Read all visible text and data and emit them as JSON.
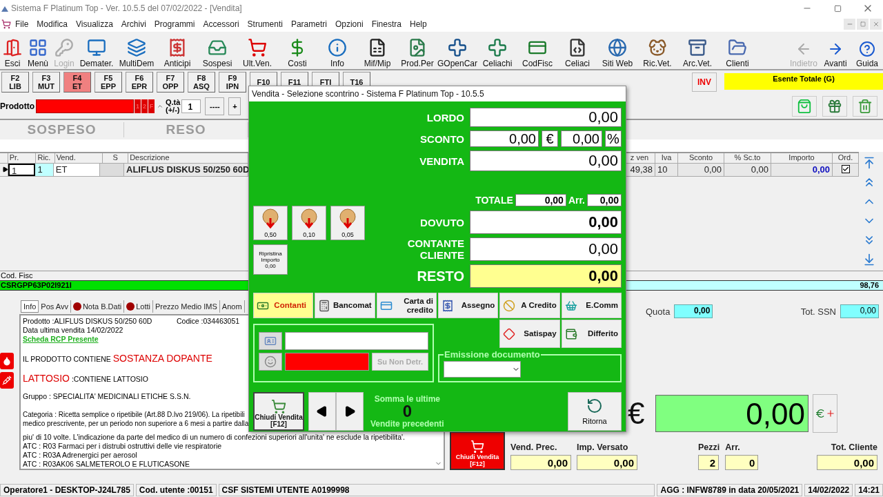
{
  "window": {
    "title": "Sistema F Platinum Top - Ver. 10.5.5 del 07/02/2022 - [Vendita]"
  },
  "menu": [
    "File",
    "Modifica",
    "Visualizza",
    "Archivi",
    "Programmi",
    "Accessori",
    "Strumenti",
    "Parametri",
    "Opzioni",
    "Finestra",
    "Help"
  ],
  "toolbar": [
    {
      "label": "Esci",
      "disabled": false
    },
    {
      "label": "Menù",
      "disabled": false
    },
    {
      "label": "Login",
      "disabled": true
    },
    {
      "label": "Demater.",
      "disabled": false
    },
    {
      "label": "MultiDem",
      "disabled": false
    },
    {
      "label": "Anticipi",
      "disabled": false
    },
    {
      "label": "Sospesi",
      "disabled": false
    },
    {
      "label": "Ult.Ven.",
      "disabled": false
    },
    {
      "label": "Costi",
      "disabled": false
    },
    {
      "label": "Info",
      "disabled": false
    },
    {
      "label": "Mif/Mip",
      "disabled": false
    },
    {
      "label": "Prod.Per",
      "disabled": false
    },
    {
      "label": "GOpenCar",
      "disabled": false
    },
    {
      "label": "Celiachi",
      "disabled": false
    },
    {
      "label": "CodFisc",
      "disabled": false
    },
    {
      "label": "Celiaci",
      "disabled": false
    },
    {
      "label": "Siti Web",
      "disabled": false
    },
    {
      "label": "Ric.Vet.",
      "disabled": false
    },
    {
      "label": "Arc.Vet.",
      "disabled": false
    },
    {
      "label": "Clienti",
      "disabled": false
    }
  ],
  "nav_toolbar": [
    {
      "label": "Indietro",
      "disabled": true
    },
    {
      "label": "Avanti",
      "disabled": false
    },
    {
      "label": "Guida",
      "disabled": false
    }
  ],
  "function_keys": [
    {
      "key": "F2",
      "code": "LIB",
      "selected": false
    },
    {
      "key": "F3",
      "code": "MUT",
      "selected": false
    },
    {
      "key": "F4",
      "code": "ET",
      "selected": true
    },
    {
      "key": "F5",
      "code": "EPP",
      "selected": false
    },
    {
      "key": "F6",
      "code": "EPR",
      "selected": false
    },
    {
      "key": "F7",
      "code": "OPP",
      "selected": false
    },
    {
      "key": "F8",
      "code": "ASQ",
      "selected": false
    },
    {
      "key": "F9",
      "code": "IPN",
      "selected": false
    },
    {
      "key": "F10",
      "selected": false
    },
    {
      "key": "F11",
      "selected": false
    },
    {
      "key": "FTI",
      "selected": false
    },
    {
      "key": "T16",
      "selected": false
    }
  ],
  "inv_button": "INV",
  "exemption": "Esente Totale (G)",
  "product": {
    "label": "Prodotto",
    "flags": [
      "1",
      "2",
      "F"
    ],
    "qty_label": "Q.tà",
    "qty_sub": "(+/-)",
    "qty": "1",
    "more_button": "----",
    "plus_button": "+"
  },
  "modes": [
    {
      "label": "SOSPESO",
      "disabled": true
    },
    {
      "label": "RESO",
      "disabled": true
    }
  ],
  "table": {
    "columns_left": [
      "Pr.",
      "Ric.",
      "Vend.",
      "S",
      "Descrizione"
    ],
    "columns_right": [
      "z ven",
      "Iva",
      "Sconto",
      "% Sc.to",
      "Importo",
      "Ord."
    ],
    "rows": [
      {
        "pr": "1",
        "ric": "1",
        "vend": "ET",
        "descrizione": "ALIFLUS DISKUS 50/250 60D",
        "prz_ven": "49,38",
        "iva": "10",
        "sconto": "0,00",
        "perc_sconto": "0,00",
        "importo": "0,00",
        "ord": true
      }
    ]
  },
  "cod_fisc": {
    "label": "Cod. Fisc",
    "value": "CSRGPP63P02I921I"
  },
  "total_bar": "98,76",
  "info_tabs": [
    {
      "label": "Info",
      "selected": true,
      "alert": false
    },
    {
      "label": "Pos Avv",
      "selected": false,
      "alert": false
    },
    {
      "label": "Nota B.Dati",
      "selected": false,
      "alert": true
    },
    {
      "label": "Lotti",
      "selected": false,
      "alert": true
    },
    {
      "label": "Prezzo Medio IMS",
      "selected": false,
      "alert": false
    },
    {
      "label": "Anom",
      "selected": false,
      "alert": false
    }
  ],
  "info": {
    "product": "Prodotto :ALIFLUS DISKUS 50/250 60D",
    "code": "Codice :034463051",
    "last_sale": "Data ultima vendita 14/02/2022",
    "rcp_link": "Scheda RCP Presente",
    "doping_prefix": "IL PRODOTTO CONTIENE",
    "doping_alert": "SOSTANZA DOPANTE",
    "lactose_alert": "LATTOSIO",
    "lactose_text": ":CONTIENE LATTOSIO",
    "group": "Gruppo : SPECIALITA' MEDICINALI ETICHE S.S.N.",
    "category_lines": [
      "Categoria : Ricetta semplice o ripetibile (Art.88 D.lvo 219/06).  La ripetibili",
      "medico prescrivente, per un periodo non superiore a 6 mesi a partire dalla"
    ],
    "lines": [
      "piu' di 10 volte. L'indicazione da parte del medico di un numero di confezioni superiori all'unita' ne esclude la ripetibilita'.",
      "ATC : R03 Farmaci per i distrubi ostruttivi delle vie respiratorie",
      "ATC : R03A Adrenergici per aerosol",
      "ATC : R03AK06 SALMETEROLO E FLUTICASONE"
    ]
  },
  "right_panel": {
    "quota_label": "Quota",
    "quota": "0,00",
    "ssn_label": "Tot. SSN",
    "ssn": "0,00",
    "currency": "€",
    "amount": "0,00"
  },
  "footer": {
    "close_button": {
      "title": "Chiudi Vendita",
      "key": "[F12]"
    },
    "fields": [
      {
        "label": "Vend. Prec.",
        "value": "0,00"
      },
      {
        "label": "Imp. Versato",
        "value": "0,00"
      },
      {
        "label": "Pezzi",
        "value": "2"
      },
      {
        "label": "Arr.",
        "value": "0"
      },
      {
        "label": "Tot. Cliente",
        "value": "0,00"
      }
    ]
  },
  "status_bar": [
    "Operatore1 - DESKTOP-J24L785",
    "Cod. utente :00151",
    "CSF SISTEMI UTENTE A0199998",
    "AGG : INFW8789 in data 20/05/2021",
    "14/02/2022",
    "14:21"
  ],
  "dialog": {
    "title": "Vendita - Selezione scontrino - Sistema F Platinum Top - 10.5.5",
    "lordo": {
      "label": "LORDO",
      "value": "0,00"
    },
    "sconto": {
      "label": "SCONTO",
      "value": "0,00",
      "unit": "€",
      "percent": "0,00",
      "percent_unit": "%"
    },
    "vendita": {
      "label": "VENDITA",
      "value": "0,00"
    },
    "totale": {
      "label": "TOTALE",
      "value": "0,00",
      "arr_label": "Arr.",
      "arr": "0,00"
    },
    "coins": [
      "0,50",
      "0,10",
      "0,05"
    ],
    "reset": {
      "label": "Ripristina Importo",
      "value": "0,00"
    },
    "dovuto": {
      "label": "DOVUTO",
      "value": "0,00"
    },
    "contante": {
      "label": "CONTANTE CLIENTE",
      "value": "0,00"
    },
    "resto": {
      "label": "RESTO",
      "value": "0,00"
    },
    "payments": [
      {
        "label": "Contanti",
        "selected": true
      },
      {
        "label": "Bancomat",
        "selected": false
      },
      {
        "label": "Carta di credito",
        "selected": false
      },
      {
        "label": "Assegno",
        "selected": false
      },
      {
        "label": "A Credito",
        "selected": false
      },
      {
        "label": "E.Comm",
        "selected": false
      },
      {
        "label": "Satispay",
        "selected": false
      },
      {
        "label": "Differito",
        "selected": false
      }
    ],
    "card_button": "Su Non Detr.",
    "document_legend": "Emissione documento",
    "close_button": {
      "title": "Chiudi Vendita",
      "key": "[F12]"
    },
    "history": {
      "top": "Somma le ultime",
      "count": "0",
      "bottom": "Vendite precedenti"
    },
    "return_button": "Ritorna"
  }
}
